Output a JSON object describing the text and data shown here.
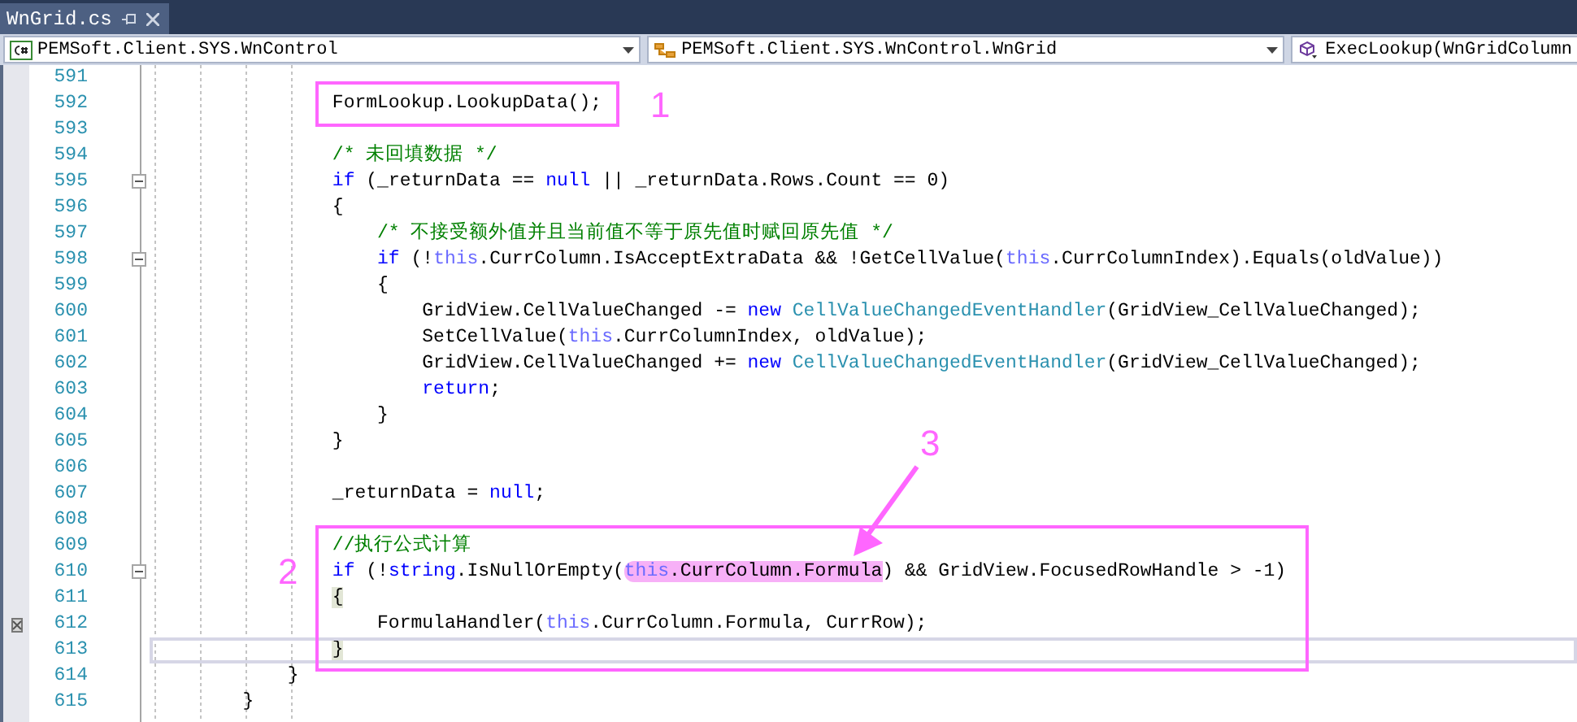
{
  "tabs": [
    {
      "label": "WnGrid.cs",
      "selected": true
    }
  ],
  "nav_bar": [
    {
      "kind": "project",
      "text": "PEMSoft.Client.SYS.WnControl"
    },
    {
      "kind": "class",
      "text": "PEMSoft.Client.SYS.WnControl.WnGrid"
    },
    {
      "kind": "method",
      "text": "ExecLookup(WnGridColumn"
    }
  ],
  "code_lines": [
    {
      "number": "591",
      "collapsible": false,
      "current": false,
      "glyph": false
    },
    {
      "number": "592",
      "collapsible": false,
      "current": false,
      "glyph": false,
      "tokens": [
        {
          "kind": "plain",
          "text": "                FormLookup.LookupData();"
        }
      ]
    },
    {
      "number": "593",
      "collapsible": false,
      "current": false,
      "glyph": false
    },
    {
      "number": "594",
      "collapsible": false,
      "current": false,
      "glyph": false,
      "tokens": [
        {
          "kind": "comment",
          "text": "                /* 未回填数据 */"
        }
      ]
    },
    {
      "number": "595",
      "collapsible": true,
      "current": false,
      "glyph": false,
      "tokens": [
        {
          "kind": "keyword",
          "text": "                if"
        },
        {
          "kind": "plain",
          "text": " (_returnData == "
        },
        {
          "kind": "keyword",
          "text": "null"
        },
        {
          "kind": "plain",
          "text": " || _returnData.Rows.Count == 0)"
        }
      ]
    },
    {
      "number": "596",
      "collapsible": false,
      "current": false,
      "glyph": false,
      "tokens": [
        {
          "kind": "plain",
          "text": "                {"
        }
      ]
    },
    {
      "number": "597",
      "collapsible": false,
      "current": false,
      "glyph": false,
      "tokens": [
        {
          "kind": "comment",
          "text": "                    /* 不接受额外值并且当前值不等于原先值时赋回原先值 */"
        }
      ]
    },
    {
      "number": "598",
      "collapsible": true,
      "current": false,
      "glyph": false,
      "tokens": [
        {
          "kind": "keyword",
          "text": "                    if"
        },
        {
          "kind": "plain",
          "text": " (!"
        },
        {
          "kind": "this",
          "text": "this"
        },
        {
          "kind": "plain",
          "text": ".CurrColumn.IsAcceptExtraData && !GetCellValue("
        },
        {
          "kind": "this",
          "text": "this"
        },
        {
          "kind": "plain",
          "text": ".CurrColumnIndex).Equals(oldValue))"
        }
      ]
    },
    {
      "number": "599",
      "collapsible": false,
      "current": false,
      "glyph": false,
      "tokens": [
        {
          "kind": "plain",
          "text": "                    {"
        }
      ]
    },
    {
      "number": "600",
      "collapsible": false,
      "current": false,
      "glyph": false,
      "tokens": [
        {
          "kind": "plain",
          "text": "                        GridView.CellValueChanged -= "
        },
        {
          "kind": "keyword",
          "text": "new"
        },
        {
          "kind": "type",
          "text": " CellValueChangedEventHandler"
        },
        {
          "kind": "plain",
          "text": "(GridView_CellValueChanged);"
        }
      ]
    },
    {
      "number": "601",
      "collapsible": false,
      "current": false,
      "glyph": false,
      "tokens": [
        {
          "kind": "plain",
          "text": "                        SetCellValue("
        },
        {
          "kind": "this",
          "text": "this"
        },
        {
          "kind": "plain",
          "text": ".CurrColumnIndex, oldValue);"
        }
      ]
    },
    {
      "number": "602",
      "collapsible": false,
      "current": false,
      "glyph": false,
      "tokens": [
        {
          "kind": "plain",
          "text": "                        GridView.CellValueChanged += "
        },
        {
          "kind": "keyword",
          "text": "new"
        },
        {
          "kind": "type",
          "text": " CellValueChangedEventHandler"
        },
        {
          "kind": "plain",
          "text": "(GridView_CellValueChanged);"
        }
      ]
    },
    {
      "number": "603",
      "collapsible": false,
      "current": false,
      "glyph": false,
      "tokens": [
        {
          "kind": "keyword",
          "text": "                        return"
        },
        {
          "kind": "plain",
          "text": ";"
        }
      ]
    },
    {
      "number": "604",
      "collapsible": false,
      "current": false,
      "glyph": false,
      "tokens": [
        {
          "kind": "plain",
          "text": "                    }"
        }
      ]
    },
    {
      "number": "605",
      "collapsible": false,
      "current": false,
      "glyph": false,
      "tokens": [
        {
          "kind": "plain",
          "text": "                }"
        }
      ]
    },
    {
      "number": "606",
      "collapsible": false,
      "current": false,
      "glyph": false
    },
    {
      "number": "607",
      "collapsible": false,
      "current": false,
      "glyph": false,
      "tokens": [
        {
          "kind": "plain",
          "text": "                _returnData = "
        },
        {
          "kind": "keyword",
          "text": "null"
        },
        {
          "kind": "plain",
          "text": ";"
        }
      ]
    },
    {
      "number": "608",
      "collapsible": false,
      "current": false,
      "glyph": false
    },
    {
      "number": "609",
      "collapsible": false,
      "current": false,
      "glyph": false,
      "tokens": [
        {
          "kind": "comment",
          "text": "                //执行公式计算"
        }
      ]
    },
    {
      "number": "610",
      "collapsible": true,
      "current": false,
      "glyph": false,
      "tokens": [
        {
          "kind": "keyword",
          "text": "                if"
        },
        {
          "kind": "plain",
          "text": " (!"
        },
        {
          "kind": "keyword",
          "text": "string"
        },
        {
          "kind": "plain",
          "text": ".IsNullOrEmpty("
        },
        {
          "kind": "marked_this",
          "text": "this"
        },
        {
          "kind": "marked",
          "text": ".CurrColumn.Formula"
        },
        {
          "kind": "plain",
          "text": ") && GridView.FocusedRowHandle > -1)"
        }
      ]
    },
    {
      "number": "611",
      "collapsible": false,
      "current": false,
      "glyph": false,
      "tokens": [
        {
          "kind": "brace",
          "text": "                {"
        }
      ]
    },
    {
      "number": "612",
      "collapsible": false,
      "current": false,
      "glyph": true,
      "tokens": [
        {
          "kind": "plain",
          "text": "                    FormulaHandler("
        },
        {
          "kind": "this",
          "text": "this"
        },
        {
          "kind": "plain",
          "text": ".CurrColumn.Formula, CurrRow);"
        }
      ]
    },
    {
      "number": "613",
      "collapsible": false,
      "current": true,
      "glyph": false,
      "tokens": [
        {
          "kind": "brace",
          "text": "                }"
        }
      ]
    },
    {
      "number": "614",
      "collapsible": false,
      "current": false,
      "glyph": false,
      "tokens": [
        {
          "kind": "plain",
          "text": "            }"
        }
      ]
    },
    {
      "number": "615",
      "collapsible": false,
      "current": false,
      "glyph": false,
      "tokens": [
        {
          "kind": "plain",
          "text": "        }"
        }
      ]
    }
  ],
  "annotations": [
    {
      "kind": "box",
      "label": "1"
    },
    {
      "kind": "box",
      "label": "2"
    },
    {
      "kind": "arrow",
      "label": "3"
    }
  ]
}
